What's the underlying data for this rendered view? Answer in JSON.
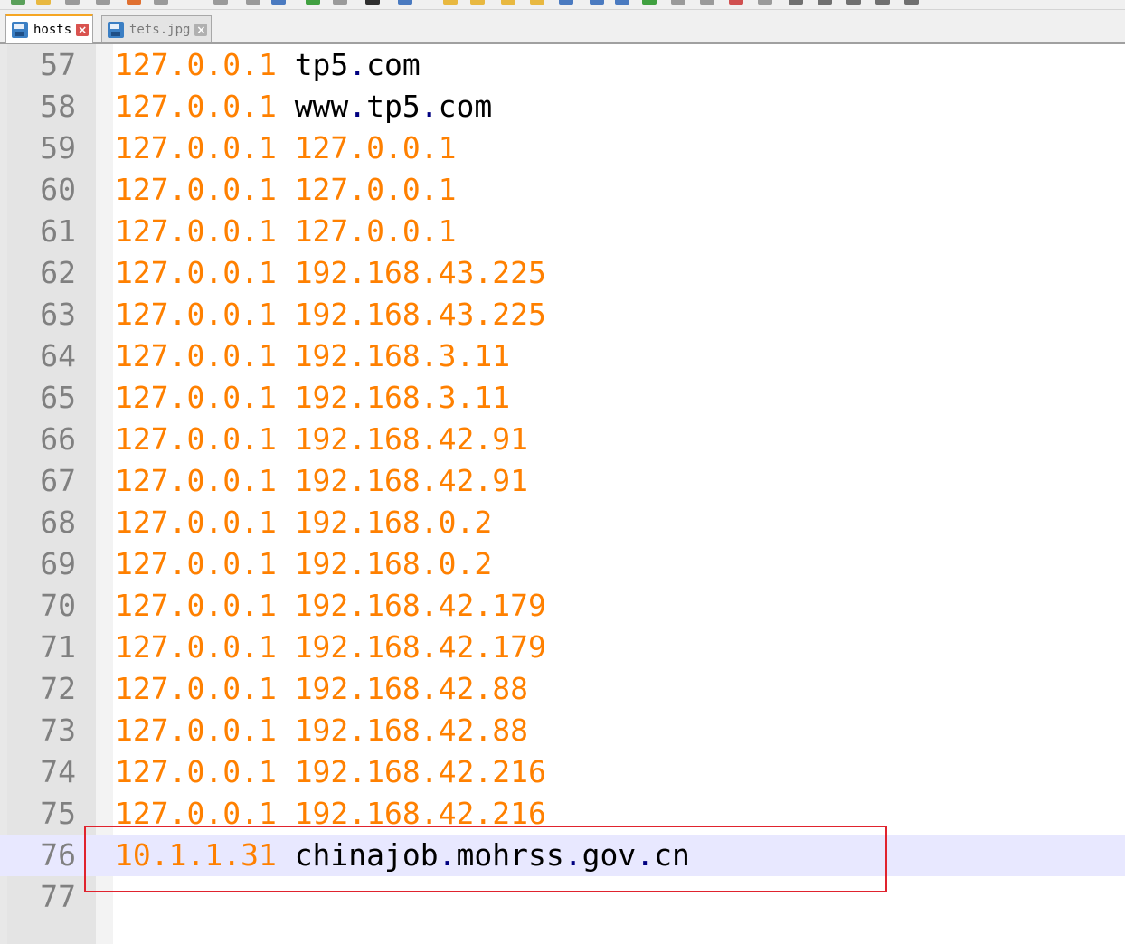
{
  "tabs": [
    {
      "label": "hosts",
      "active": true
    },
    {
      "label": "tets.jpg",
      "active": false
    }
  ],
  "lines": [
    {
      "num": "57",
      "ip": "127.0.0.1",
      "host_parts": [
        [
          "tp5",
          "host"
        ],
        [
          ".",
          "dot"
        ],
        [
          "com",
          "host"
        ]
      ]
    },
    {
      "num": "58",
      "ip": "127.0.0.1",
      "host_parts": [
        [
          "www",
          "host"
        ],
        [
          ".",
          "dot"
        ],
        [
          "tp5",
          "host"
        ],
        [
          ".",
          "dot"
        ],
        [
          "com",
          "host"
        ]
      ]
    },
    {
      "num": "59",
      "ip": "127.0.0.1",
      "host_parts": [
        [
          "127.0.0.1",
          "ip"
        ]
      ]
    },
    {
      "num": "60",
      "ip": "127.0.0.1",
      "host_parts": [
        [
          "127.0.0.1",
          "ip"
        ]
      ]
    },
    {
      "num": "61",
      "ip": "127.0.0.1",
      "host_parts": [
        [
          "127.0.0.1",
          "ip"
        ]
      ]
    },
    {
      "num": "62",
      "ip": "127.0.0.1",
      "host_parts": [
        [
          "192.168.43.225",
          "ip"
        ]
      ]
    },
    {
      "num": "63",
      "ip": "127.0.0.1",
      "host_parts": [
        [
          "192.168.43.225",
          "ip"
        ]
      ]
    },
    {
      "num": "64",
      "ip": "127.0.0.1",
      "host_parts": [
        [
          "192.168.3.11",
          "ip"
        ]
      ]
    },
    {
      "num": "65",
      "ip": "127.0.0.1",
      "host_parts": [
        [
          "192.168.3.11",
          "ip"
        ]
      ]
    },
    {
      "num": "66",
      "ip": "127.0.0.1",
      "host_parts": [
        [
          "192.168.42.91",
          "ip"
        ]
      ]
    },
    {
      "num": "67",
      "ip": "127.0.0.1",
      "host_parts": [
        [
          "192.168.42.91",
          "ip"
        ]
      ]
    },
    {
      "num": "68",
      "ip": "127.0.0.1",
      "host_parts": [
        [
          "192.168.0.2",
          "ip"
        ]
      ]
    },
    {
      "num": "69",
      "ip": "127.0.0.1",
      "host_parts": [
        [
          "192.168.0.2",
          "ip"
        ]
      ]
    },
    {
      "num": "70",
      "ip": "127.0.0.1",
      "host_parts": [
        [
          "192.168.42.179",
          "ip"
        ]
      ]
    },
    {
      "num": "71",
      "ip": "127.0.0.1",
      "host_parts": [
        [
          "192.168.42.179",
          "ip"
        ]
      ]
    },
    {
      "num": "72",
      "ip": "127.0.0.1",
      "host_parts": [
        [
          "192.168.42.88",
          "ip"
        ]
      ]
    },
    {
      "num": "73",
      "ip": "127.0.0.1",
      "host_parts": [
        [
          "192.168.42.88",
          "ip"
        ]
      ]
    },
    {
      "num": "74",
      "ip": "127.0.0.1",
      "host_parts": [
        [
          "192.168.42.216",
          "ip"
        ]
      ]
    },
    {
      "num": "75",
      "ip": "127.0.0.1",
      "host_parts": [
        [
          "192.168.42.216",
          "ip"
        ]
      ]
    },
    {
      "num": "76",
      "ip": "10.1.1.31",
      "host_parts": [
        [
          "chinajob",
          "host"
        ],
        [
          ".",
          "dot"
        ],
        [
          "mohrss",
          "host"
        ],
        [
          ".",
          "dot"
        ],
        [
          "gov",
          "host"
        ],
        [
          ".",
          "dot"
        ],
        [
          "cn",
          "host"
        ]
      ],
      "current": true
    },
    {
      "num": "77",
      "ip": "",
      "host_parts": []
    }
  ],
  "colors": {
    "ip": "#ff8000",
    "host": "#000000",
    "dot": "#000080",
    "highlight_box": "#e0232e",
    "current_line": "#e8e8ff"
  }
}
